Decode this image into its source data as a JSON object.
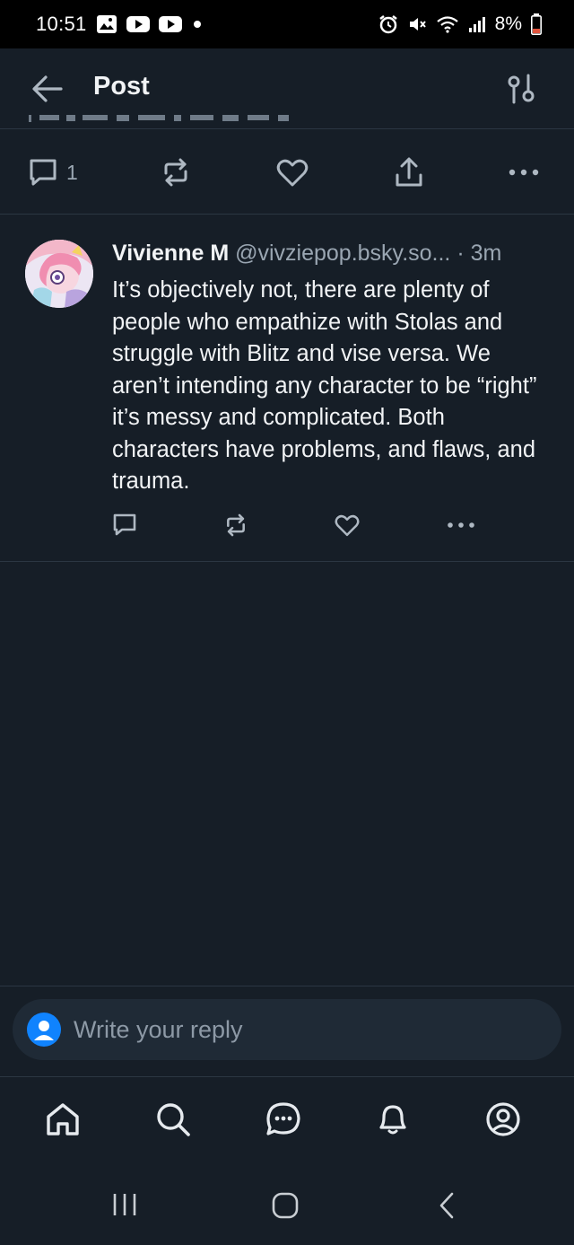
{
  "status_bar": {
    "time": "10:51",
    "battery": "8%",
    "icons": [
      "gallery-icon",
      "youtube-icon",
      "youtube-icon",
      "dot-icon",
      "alarm-icon",
      "mute-icon",
      "wifi-icon",
      "signal-icon",
      "battery-icon"
    ]
  },
  "header": {
    "title": "Post",
    "back_icon": "arrow-left-icon",
    "settings_icon": "sliders-icon"
  },
  "main_post": {
    "reply_count": "1"
  },
  "reply": {
    "name": "Vivienne M",
    "handle": "@vivziepop.bsky.so...",
    "time": "· 3m",
    "text": "It’s objectively not, there are plenty of people who empathize with Stolas and struggle with Blitz and vise versa. We aren’t intending any character to be “right” it’s messy and complicated. Both characters have problems, and flaws, and trauma."
  },
  "composer": {
    "placeholder": "Write your reply"
  },
  "bottom_nav": [
    "home-icon",
    "search-icon",
    "chat-icon",
    "bell-icon",
    "profile-icon"
  ],
  "colors": {
    "background": "#161e27",
    "divider": "#2b3642",
    "muted_text": "#9aa6b2",
    "composer_bg": "#1f2a36",
    "accent": "#1083fe"
  }
}
